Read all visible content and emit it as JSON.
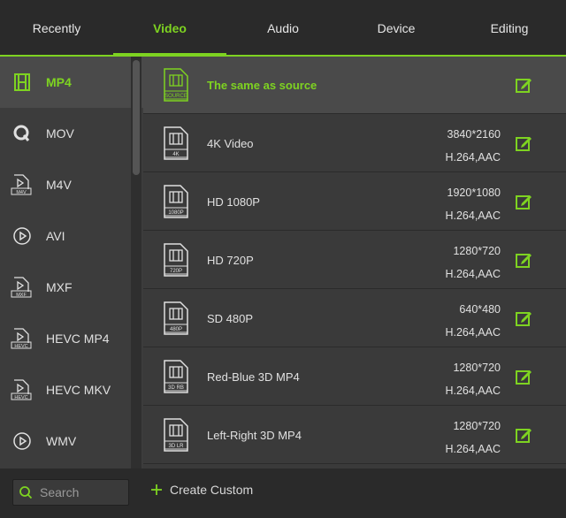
{
  "tabs": [
    {
      "label": "Recently",
      "active": false
    },
    {
      "label": "Video",
      "active": true
    },
    {
      "label": "Audio",
      "active": false
    },
    {
      "label": "Device",
      "active": false
    },
    {
      "label": "Editing",
      "active": false
    }
  ],
  "sidebar": {
    "items": [
      {
        "label": "MP4",
        "icon": "film-icon",
        "active": true
      },
      {
        "label": "MOV",
        "icon": "quicktime-icon",
        "active": false
      },
      {
        "label": "M4V",
        "icon": "m4v-file-icon",
        "active": false
      },
      {
        "label": "AVI",
        "icon": "play-circle-icon",
        "active": false
      },
      {
        "label": "MXF",
        "icon": "mxf-file-icon",
        "active": false
      },
      {
        "label": "HEVC MP4",
        "icon": "hevc-file-icon",
        "active": false
      },
      {
        "label": "HEVC MKV",
        "icon": "hevc-file-icon",
        "active": false
      },
      {
        "label": "WMV",
        "icon": "play-circle-icon",
        "active": false
      }
    ]
  },
  "presets": [
    {
      "name": "The same as source",
      "badge": "SOURCE",
      "resolution": "",
      "codec": "",
      "selected": true
    },
    {
      "name": "4K Video",
      "badge": "4K",
      "resolution": "3840*2160",
      "codec": "H.264,AAC",
      "selected": false
    },
    {
      "name": "HD 1080P",
      "badge": "1080P",
      "resolution": "1920*1080",
      "codec": "H.264,AAC",
      "selected": false
    },
    {
      "name": "HD 720P",
      "badge": "720P",
      "resolution": "1280*720",
      "codec": "H.264,AAC",
      "selected": false
    },
    {
      "name": "SD 480P",
      "badge": "480P",
      "resolution": "640*480",
      "codec": "H.264,AAC",
      "selected": false
    },
    {
      "name": "Red-Blue 3D MP4",
      "badge": "3D RB",
      "resolution": "1280*720",
      "codec": "H.264,AAC",
      "selected": false
    },
    {
      "name": "Left-Right 3D MP4",
      "badge": "3D LR",
      "resolution": "1280*720",
      "codec": "H.264,AAC",
      "selected": false
    }
  ],
  "sidebar_badges": {
    "m4v": "M4V",
    "mxf": "MXF",
    "hevc": "HEVC"
  },
  "search": {
    "placeholder": "Search",
    "value": ""
  },
  "footer": {
    "create_label": "Create Custom"
  },
  "colors": {
    "accent": "#7ed321",
    "background": "#3a3a3a",
    "bar": "#2a2a2a"
  }
}
